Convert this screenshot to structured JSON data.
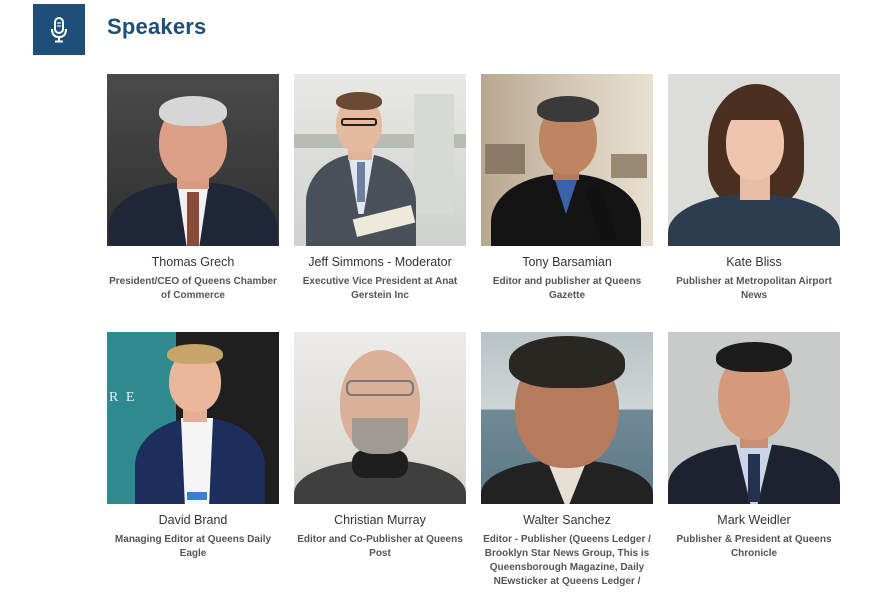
{
  "header": {
    "title": "Speakers",
    "icon": "microphone-icon",
    "accent": "#1d4f78"
  },
  "speakers": [
    {
      "name": "Thomas Grech",
      "role": "President/CEO of Queens Chamber of Commerce"
    },
    {
      "name": "Jeff Simmons - Moderator",
      "role": "Executive Vice President at Anat Gerstein Inc"
    },
    {
      "name": "Tony Barsamian",
      "role": "Editor and publisher at Queens Gazette"
    },
    {
      "name": "Kate Bliss",
      "role": "Publisher at Metropolitan Airport News"
    },
    {
      "name": "David Brand",
      "role": "Managing Editor at Queens Daily Eagle",
      "photo_text": "R E"
    },
    {
      "name": "Christian Murray",
      "role": "Editor and Co-Publisher at Queens Post"
    },
    {
      "name": "Walter Sanchez",
      "role": "Editor - Publisher (Queens Ledger / Brooklyn Star News Group, This is Queensborough Magazine, Daily NEwsticker at Queens Ledger /"
    },
    {
      "name": "Mark Weidler",
      "role": "Publisher & President at Queens Chronicle"
    }
  ]
}
